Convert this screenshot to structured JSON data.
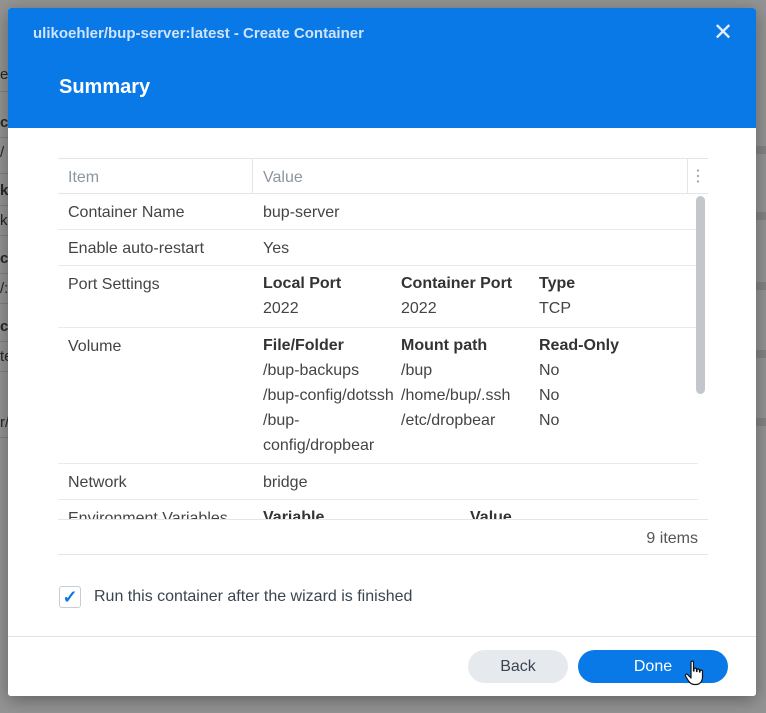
{
  "dialog": {
    "title": "ulikoehler/bup-server:latest - Create Container",
    "close_icon": "close-icon",
    "step_title": "Summary"
  },
  "background": {
    "fragments": [
      "e",
      "co",
      "/",
      "k",
      "ks",
      "c",
      "/:",
      "c",
      "te",
      "r/"
    ]
  },
  "grid": {
    "columns": [
      "Item",
      "Value"
    ],
    "menu_icon": "⋮",
    "rows": {
      "name": {
        "item": "Container Name",
        "value": "bup-server"
      },
      "restart": {
        "item": "Enable auto-restart",
        "value": "Yes"
      },
      "ports": {
        "item": "Port Settings",
        "headers": [
          "Local Port",
          "Container Port",
          "Type"
        ],
        "values": [
          "2022",
          "2022",
          "TCP"
        ]
      },
      "volume": {
        "item": "Volume",
        "headers": [
          "File/Folder",
          "Mount path",
          "Read-Only"
        ],
        "r1": [
          "/bup-backups",
          "/bup",
          "No"
        ],
        "r2": [
          "/bup-config/dotssh",
          "/home/bup/.ssh",
          "No"
        ],
        "r3_line1": "/bup-",
        "r3_line2": "config/dropbear",
        "r3_mount": "/etc/dropbear",
        "r3_ro": "No"
      },
      "network": {
        "item": "Network",
        "value": "bridge"
      },
      "env": {
        "item": "Environment Variables",
        "headers": [
          "Variable",
          "Value"
        ]
      }
    },
    "footer": {
      "count": "9 items"
    }
  },
  "options": {
    "run_after_wizard": {
      "checked": true,
      "label": "Run this container after the wizard is finished"
    }
  },
  "buttons": {
    "back": "Back",
    "done": "Done"
  },
  "colors": {
    "accent": "#0a79e8",
    "header": "#0a79e8"
  }
}
